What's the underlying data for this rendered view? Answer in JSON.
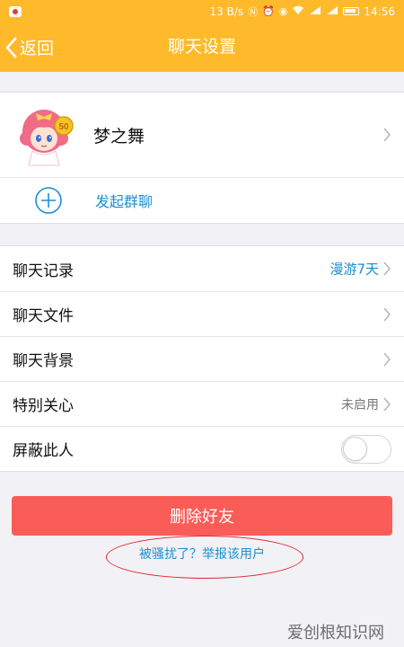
{
  "status_bar": {
    "speed": "13 B/s",
    "icons": [
      "nfc-icon",
      "alarm-icon",
      "eye-icon",
      "wifi-icon",
      "signal-icon",
      "battery-icon"
    ],
    "time": "14:56"
  },
  "nav": {
    "back_label": "返回",
    "title": "聊天设置"
  },
  "profile": {
    "name": "梦之舞"
  },
  "group": {
    "label": "发起群聊"
  },
  "settings": {
    "rows": [
      {
        "label": "聊天记录",
        "value": "漫游7天"
      },
      {
        "label": "聊天文件",
        "value": ""
      },
      {
        "label": "聊天背景",
        "value": ""
      },
      {
        "label": "特别关心",
        "value": "未启用"
      },
      {
        "label": "屏蔽此人",
        "toggle_on": false
      }
    ]
  },
  "actions": {
    "delete_label": "删除好友",
    "report_label": "被骚扰了？举报该用户"
  },
  "watermark": "爱创根知识网",
  "colors": {
    "header": "#ffba2b",
    "link_blue": "#1a8fd1",
    "delete_red": "#fa5c57",
    "annotation_red": "#e2232a"
  }
}
